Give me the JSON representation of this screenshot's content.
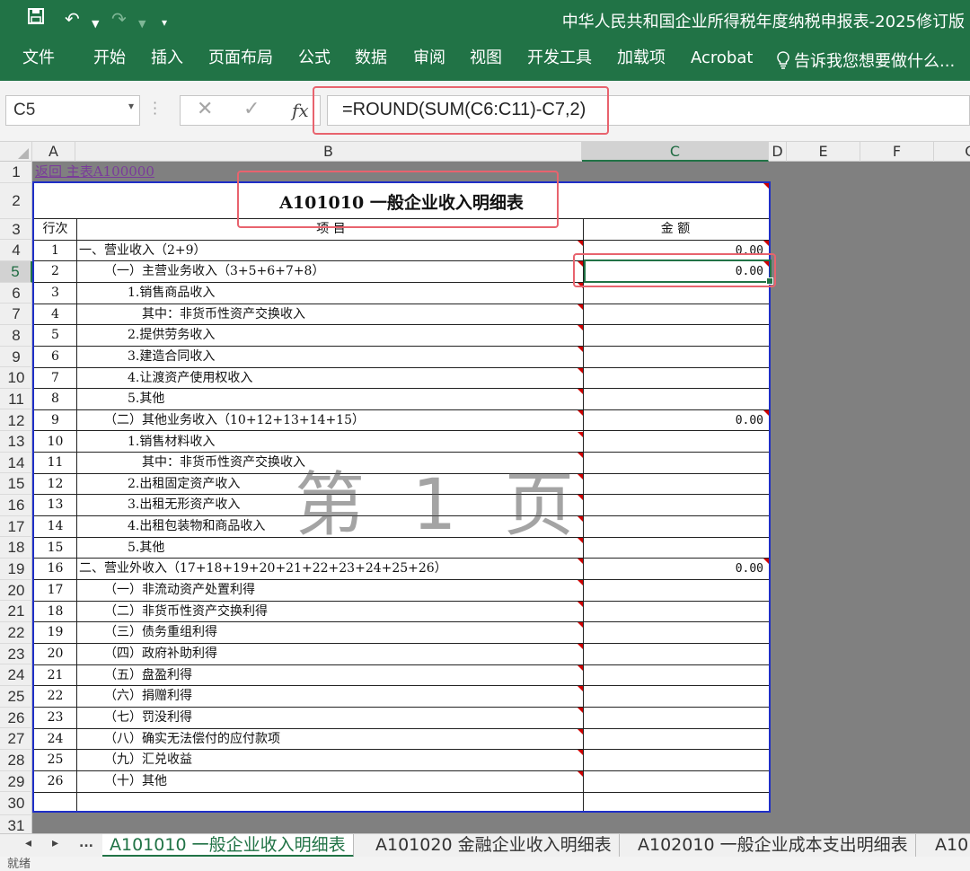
{
  "titlebar": {
    "title": "中华人民共和国企业所得税年度纳税申报表-2025修订版"
  },
  "ribbon": {
    "tabs": [
      "文件",
      "开始",
      "插入",
      "页面布局",
      "公式",
      "数据",
      "审阅",
      "视图",
      "开发工具",
      "加载项",
      "Acrobat"
    ],
    "tell_me": "告诉我您想要做什么..."
  },
  "formula_bar": {
    "name_box": "C5",
    "formula": "=ROUND(SUM(C6:C11)-C7,2)",
    "fx_label": "fx"
  },
  "columns": [
    "A",
    "B",
    "C",
    "D",
    "E",
    "F",
    "G"
  ],
  "selected_cell": "C5",
  "sheet": {
    "back_link": "返回  主表A100000",
    "title": "A101010  一般企业收入明细表",
    "header": {
      "col_a": "行次",
      "col_b": "项           目",
      "col_c": "金      额"
    },
    "rows": [
      {
        "line": "1",
        "item": "一、营业收入（2+9）",
        "amount": "0.00"
      },
      {
        "line": "2",
        "item": "（一）主营业务收入（3+5+6+7+8）",
        "amount": "0.00"
      },
      {
        "line": "3",
        "item": "1.销售商品收入",
        "amount": ""
      },
      {
        "line": "4",
        "item": "其中：非货币性资产交换收入",
        "amount": ""
      },
      {
        "line": "5",
        "item": "2.提供劳务收入",
        "amount": ""
      },
      {
        "line": "6",
        "item": "3.建造合同收入",
        "amount": ""
      },
      {
        "line": "7",
        "item": "4.让渡资产使用权收入",
        "amount": ""
      },
      {
        "line": "8",
        "item": "5.其他",
        "amount": ""
      },
      {
        "line": "9",
        "item": "（二）其他业务收入（10+12+13+14+15）",
        "amount": "0.00"
      },
      {
        "line": "10",
        "item": "1.销售材料收入",
        "amount": ""
      },
      {
        "line": "11",
        "item": "其中：非货币性资产交换收入",
        "amount": ""
      },
      {
        "line": "12",
        "item": "2.出租固定资产收入",
        "amount": ""
      },
      {
        "line": "13",
        "item": "3.出租无形资产收入",
        "amount": ""
      },
      {
        "line": "14",
        "item": "4.出租包装物和商品收入",
        "amount": ""
      },
      {
        "line": "15",
        "item": "5.其他",
        "amount": ""
      },
      {
        "line": "16",
        "item": "二、营业外收入（17+18+19+20+21+22+23+24+25+26）",
        "amount": "0.00"
      },
      {
        "line": "17",
        "item": "（一）非流动资产处置利得",
        "amount": ""
      },
      {
        "line": "18",
        "item": "（二）非货币性资产交换利得",
        "amount": ""
      },
      {
        "line": "19",
        "item": "（三）债务重组利得",
        "amount": ""
      },
      {
        "line": "20",
        "item": "（四）政府补助利得",
        "amount": ""
      },
      {
        "line": "21",
        "item": "（五）盘盈利得",
        "amount": ""
      },
      {
        "line": "22",
        "item": "（六）捐赠利得",
        "amount": ""
      },
      {
        "line": "23",
        "item": "（七）罚没利得",
        "amount": ""
      },
      {
        "line": "24",
        "item": "（八）确实无法偿付的应付款项",
        "amount": ""
      },
      {
        "line": "25",
        "item": "（九）汇兑收益",
        "amount": ""
      },
      {
        "line": "26",
        "item": "（十）其他",
        "amount": ""
      }
    ],
    "watermark": "第 1 页"
  },
  "sheet_tabs": {
    "nav_more": "...",
    "tabs": [
      "A101010 一般企业收入明细表",
      "A101020 金融企业收入明细表",
      "A102010 一般企业成本支出明细表",
      "A10"
    ],
    "active_index": 0
  },
  "status": {
    "text": "就绪"
  },
  "colors": {
    "excel_green": "#217346",
    "highlight_red": "#e8636e",
    "table_border_blue": "#1f2fc7",
    "link_purple": "#7a3b9a"
  }
}
